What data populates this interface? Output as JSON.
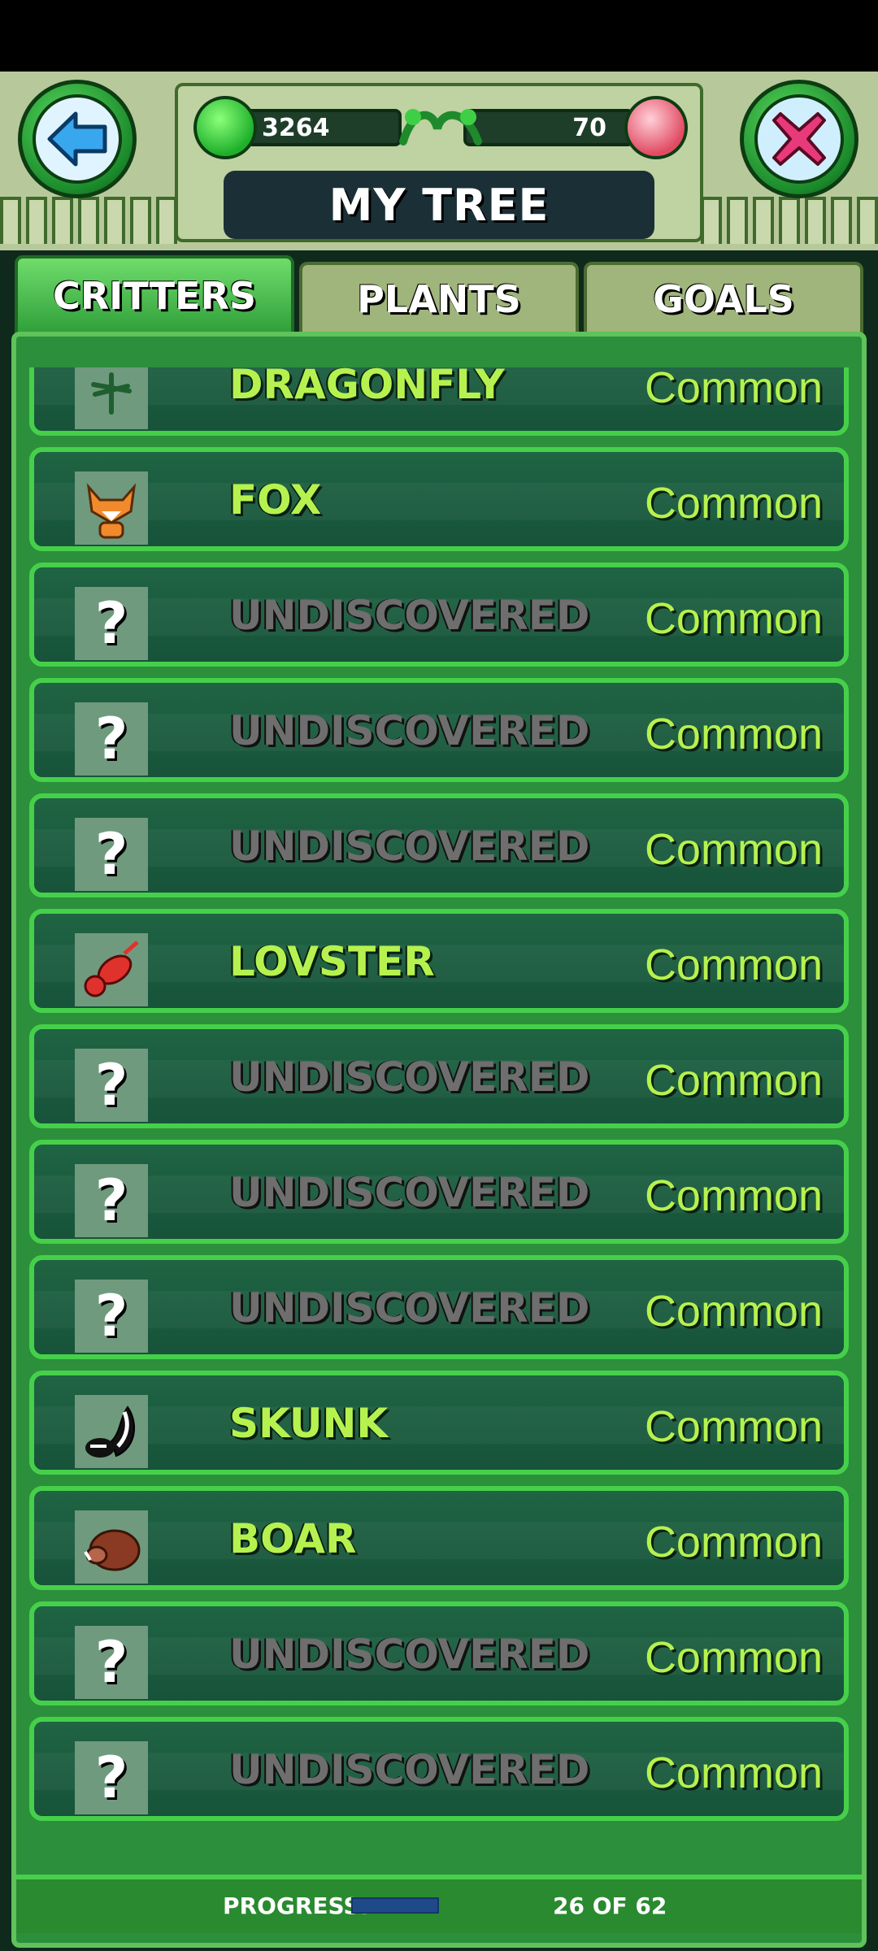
{
  "header": {
    "title": "MY TREE",
    "gems_green": "3264",
    "gems_red": "70",
    "back_icon": "arrow-left-icon",
    "close_icon": "close-x-icon"
  },
  "tabs": [
    {
      "label": "CRITTERS",
      "active": true
    },
    {
      "label": "PLANTS",
      "active": false
    },
    {
      "label": "GOALS",
      "active": false
    }
  ],
  "rows": [
    {
      "name": "DRAGONFLY",
      "rarity": "Common",
      "discovered": true,
      "icon": "dragonfly-icon"
    },
    {
      "name": "FOX",
      "rarity": "Common",
      "discovered": true,
      "icon": "fox-icon"
    },
    {
      "name": "UNDISCOVERED",
      "rarity": "Common",
      "discovered": false,
      "icon": "question-mark-icon"
    },
    {
      "name": "UNDISCOVERED",
      "rarity": "Common",
      "discovered": false,
      "icon": "question-mark-icon"
    },
    {
      "name": "UNDISCOVERED",
      "rarity": "Common",
      "discovered": false,
      "icon": "question-mark-icon"
    },
    {
      "name": "LOVSTER",
      "rarity": "Common",
      "discovered": true,
      "icon": "lobster-icon"
    },
    {
      "name": "UNDISCOVERED",
      "rarity": "Common",
      "discovered": false,
      "icon": "question-mark-icon"
    },
    {
      "name": "UNDISCOVERED",
      "rarity": "Common",
      "discovered": false,
      "icon": "question-mark-icon"
    },
    {
      "name": "UNDISCOVERED",
      "rarity": "Common",
      "discovered": false,
      "icon": "question-mark-icon"
    },
    {
      "name": "SKUNK",
      "rarity": "Common",
      "discovered": true,
      "icon": "skunk-icon"
    },
    {
      "name": "BOAR",
      "rarity": "Common",
      "discovered": true,
      "icon": "boar-icon"
    },
    {
      "name": "UNDISCOVERED",
      "rarity": "Common",
      "discovered": false,
      "icon": "question-mark-icon"
    },
    {
      "name": "UNDISCOVERED",
      "rarity": "Common",
      "discovered": false,
      "icon": "question-mark-icon"
    }
  ],
  "footer": {
    "progress_label": "PROGRESS:",
    "progress_text": "26 OF 62",
    "progress_fraction": 0.42
  },
  "colors": {
    "accent_green": "#46d04a",
    "name_green": "#b6f24f",
    "undiscovered_gray": "#6e6e6e"
  }
}
